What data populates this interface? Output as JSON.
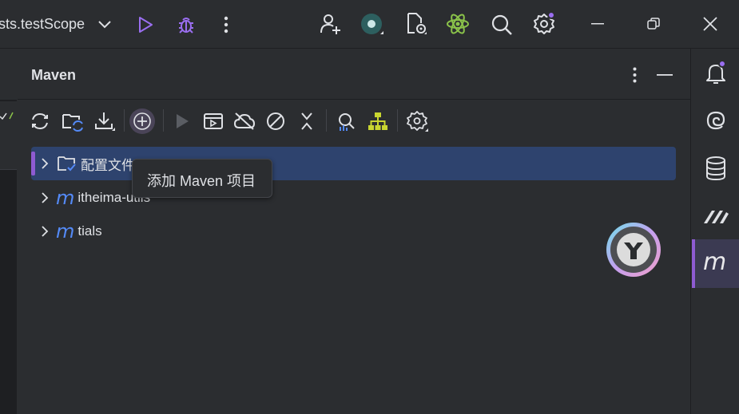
{
  "titlebar": {
    "run_config": "sts.testScope",
    "icons": [
      "chevron-down-icon",
      "run-icon",
      "debug-icon",
      "more-vertical-icon",
      "add-user-icon",
      "record-icon",
      "file-settings-icon",
      "atom-icon",
      "search-icon",
      "settings-icon",
      "minimize-icon",
      "restore-icon",
      "close-icon"
    ]
  },
  "panel": {
    "title": "Maven",
    "toolbar": [
      "reload-icon",
      "folder-sync-icon",
      "download-icon",
      "add-icon",
      "run-icon",
      "execute-goal-icon",
      "offline-icon",
      "skip-tests-icon",
      "collapse-all-icon",
      "analyze-dependencies-icon",
      "show-diagram-icon",
      "settings-icon"
    ]
  },
  "tree": {
    "items": [
      {
        "label": "配置文件",
        "icon": "profiles-folder-icon",
        "selected": true
      },
      {
        "label": "itheima-utils",
        "icon": "maven-m-icon",
        "selected": false
      },
      {
        "label": "tials",
        "icon": "maven-m-icon",
        "selected": false
      }
    ]
  },
  "tooltip": {
    "text": "添加 Maven 项目"
  },
  "right_bar": {
    "icons": [
      "notifications-icon",
      "ai-swirl-icon",
      "database-icon",
      "brand-stripes-icon",
      "maven-icon"
    ],
    "maven_glyph": "m"
  },
  "colors": {
    "accent": "#8e5bd2",
    "selection": "#2e436e",
    "maven_blue": "#548af7",
    "background": "#2b2d30"
  }
}
